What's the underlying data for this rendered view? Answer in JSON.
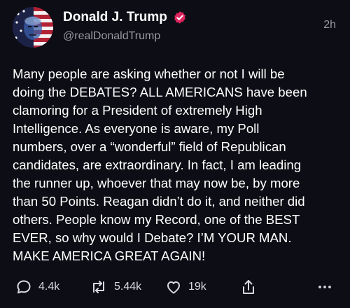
{
  "author": {
    "name": "Donald J. Trump",
    "handle": "@realDonaldTrump",
    "verified": true,
    "avatar_icon": "flag-portrait-avatar"
  },
  "timestamp": "2h",
  "post_text": "Many people are asking whether or not I will be\ndoing the DEBATES? ALL AMERICANS have been\nclamoring for a President of extremely High\nIntelligence. As everyone is aware, my Poll\nnumbers, over a “wonderful” field of Republican\ncandidates, are extraordinary. In fact, I am leading\nthe runner up, whoever that may now be, by more\nthan 50 Points. Reagan didn’t do it, and neither did\nothers. People know my Record, one of the BEST\nEVER, so why would I Debate? I’M YOUR MAN.\nMAKE AMERICA GREAT AGAIN!",
  "actions": {
    "replies": "4.4k",
    "reposts": "5.44k",
    "likes": "19k"
  },
  "colors": {
    "background": "#0d0d15",
    "verified_badge": "#e0245e",
    "muted_text": "#9a9aa5"
  }
}
